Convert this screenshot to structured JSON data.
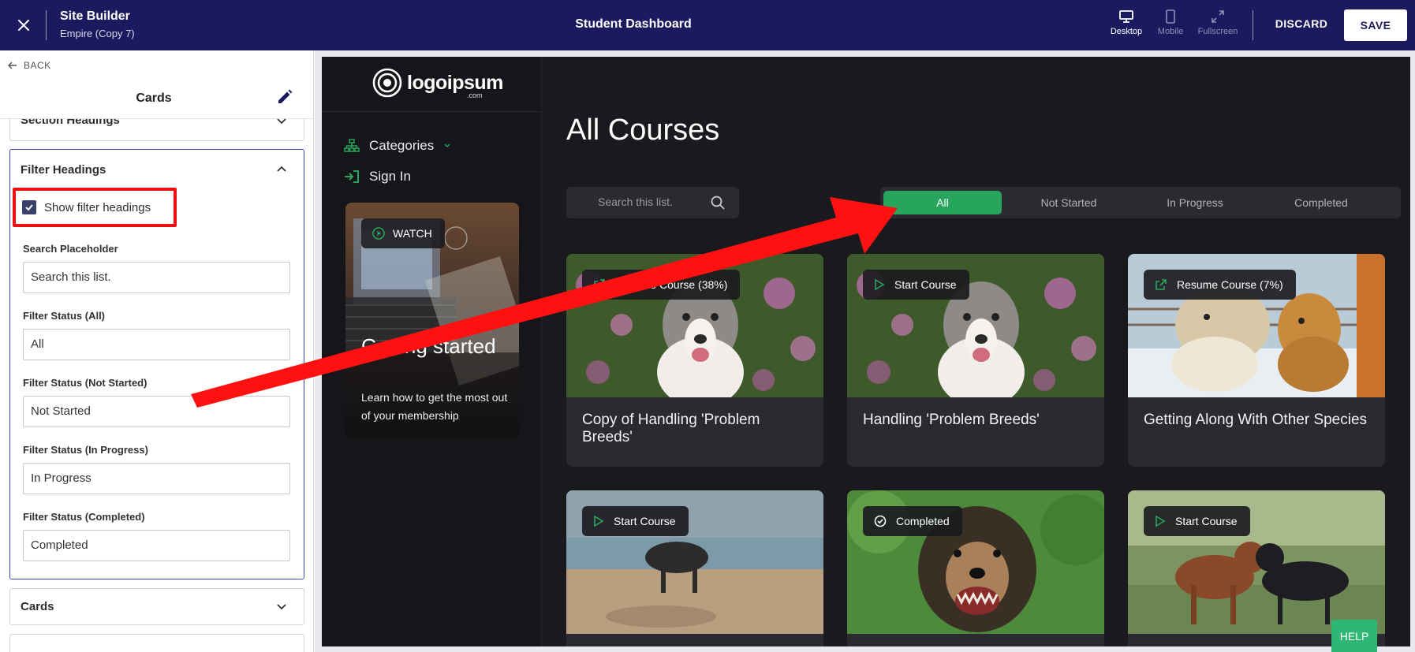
{
  "topbar": {
    "title": "Site Builder",
    "subtitle": "Empire (Copy 7)",
    "page_name": "Student Dashboard",
    "views": [
      {
        "label": "Desktop",
        "icon": "desktop-icon",
        "active": true
      },
      {
        "label": "Mobile",
        "icon": "mobile-icon",
        "active": false
      },
      {
        "label": "Fullscreen",
        "icon": "fullscreen-icon",
        "active": false
      }
    ],
    "discard_label": "DISCARD",
    "save_label": "SAVE",
    "bg_color": "#1c1a5e"
  },
  "panel": {
    "back_label": "BACK",
    "title": "Cards",
    "sections": {
      "section_headings": "Section Headings",
      "filter_headings": "Filter Headings",
      "cards": "Cards"
    },
    "show_filter_headings": {
      "label": "Show filter headings",
      "checked": true
    },
    "fields": [
      {
        "label": "Search Placeholder",
        "value": "Search this list."
      },
      {
        "label": "Filter Status (All)",
        "value": "All"
      },
      {
        "label": "Filter Status (Not Started)",
        "value": "Not Started"
      },
      {
        "label": "Filter Status (In Progress)",
        "value": "In Progress"
      },
      {
        "label": "Filter Status (Completed)",
        "value": "Completed"
      }
    ]
  },
  "site": {
    "logo_text": "logoipsum",
    "logo_suffix": ".com",
    "nav": [
      {
        "label": "Categories",
        "icon": "sitemap-icon"
      },
      {
        "label": "Sign In",
        "icon": "sign-in-icon"
      }
    ],
    "watch_card": {
      "pill": "WATCH",
      "title": "Getting started",
      "description": "Learn how to get the most out of your membership"
    },
    "page_title": "All Courses",
    "search_placeholder": "Search this list.",
    "filters": [
      "All",
      "Not Started",
      "In Progress",
      "Completed"
    ],
    "active_filter": "All",
    "accent_color": "#27a55d",
    "cards": [
      {
        "pill": "Resume Course (38%)",
        "icon": "resume-icon",
        "title": "Copy of Handling 'Problem Breeds'"
      },
      {
        "pill": "Start Course",
        "icon": "play-icon",
        "title": "Handling 'Problem Breeds'"
      },
      {
        "pill": "Resume Course (7%)",
        "icon": "resume-icon",
        "title": "Getting Along With Other Species"
      },
      {
        "pill": "Start Course",
        "icon": "play-icon",
        "title": ""
      },
      {
        "pill": "Completed",
        "icon": "check-circle-icon",
        "title": ""
      },
      {
        "pill": "Start Course",
        "icon": "play-icon",
        "title": ""
      }
    ]
  },
  "help_label": "HELP",
  "annotation_color": "#ee1111"
}
